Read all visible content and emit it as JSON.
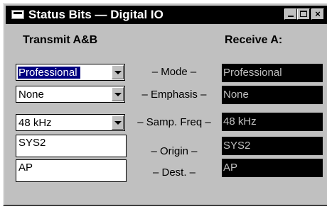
{
  "window": {
    "title": "Status Bits — Digital IO",
    "transmit_label": "Transmit A&B",
    "receive_label": "Receive A:"
  },
  "rows": [
    {
      "transmit": "Professional",
      "label": "– Mode –",
      "receive": "Professional"
    },
    {
      "transmit": "None",
      "label": "– Emphasis –",
      "receive": "None"
    },
    {
      "transmit": "48 kHz",
      "label": "– Samp. Freq –",
      "receive": "48 kHz"
    },
    {
      "transmit": "SYS2",
      "label": "– Origin –",
      "receive": "SYS2"
    },
    {
      "transmit": "AP",
      "label": "– Dest. –",
      "receive": "AP"
    }
  ],
  "icons": {
    "system_menu": "system-menu-icon",
    "minimize": "minimize-icon",
    "maximize": "maximize-icon",
    "close": "close-icon"
  }
}
